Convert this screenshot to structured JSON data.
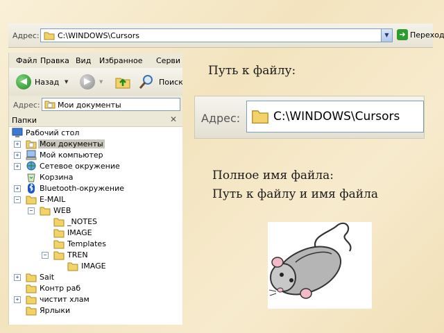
{
  "top_address_bar": {
    "label": "Адрес:",
    "path": "C:\\WINDOWS\\Cursors",
    "go_label": "Переход"
  },
  "explorer": {
    "menu": [
      "Файл",
      "Правка",
      "Вид",
      "Избранное",
      "Серви"
    ],
    "toolbar": {
      "back_label": "Назад",
      "search_label": "Поиск"
    },
    "address_label": "Адрес:",
    "address_value": "Мои документы",
    "folders_pane_title": "Папки",
    "tree": [
      {
        "label": "Рабочий стол",
        "icon": "desktop-icon"
      },
      {
        "label": "Мои документы",
        "icon": "my-documents-icon",
        "expander": "+",
        "selected": true
      },
      {
        "label": "Мой компьютер",
        "icon": "my-computer-icon",
        "expander": "+"
      },
      {
        "label": "Сетевое окружение",
        "icon": "network-icon",
        "expander": "+"
      },
      {
        "label": "Корзина",
        "icon": "recycle-bin-icon"
      },
      {
        "label": "Bluetooth-окружение",
        "icon": "bluetooth-icon",
        "expander": "+"
      },
      {
        "label": "E-MAIL",
        "icon": "folder-icon",
        "expander": "−"
      },
      {
        "label": "WEB",
        "icon": "folder-icon",
        "expander": "−"
      },
      {
        "label": "_NOTES",
        "icon": "folder-icon"
      },
      {
        "label": "IMAGE",
        "icon": "folder-icon"
      },
      {
        "label": "Templates",
        "icon": "folder-icon"
      },
      {
        "label": "TREN",
        "icon": "folder-icon",
        "expander": "−"
      },
      {
        "label": "IMAGE",
        "icon": "folder-icon"
      },
      {
        "label": "Sait",
        "icon": "folder-icon",
        "expander": "+"
      },
      {
        "label": "Контр раб",
        "icon": "folder-icon"
      },
      {
        "label": "чистит хлам",
        "icon": "folder-icon",
        "expander": "+"
      },
      {
        "label": "Ярлыки",
        "icon": "folder-icon"
      }
    ]
  },
  "slide": {
    "path_heading": "Путь к файлу:",
    "zoomed_address": {
      "label": "Адрес:",
      "path": "C:\\WINDOWS\\Cursors"
    },
    "fullname_line1": "Полное имя файла:",
    "fullname_line2": "Путь к файлу и имя файла"
  },
  "colors": {
    "slide_background": "#f7ecd0",
    "address_border": "#7f9db9",
    "go_arrow": "#2f9a2f",
    "folder_yellow": "#f2d36a",
    "selection": "#c9c6bd"
  }
}
